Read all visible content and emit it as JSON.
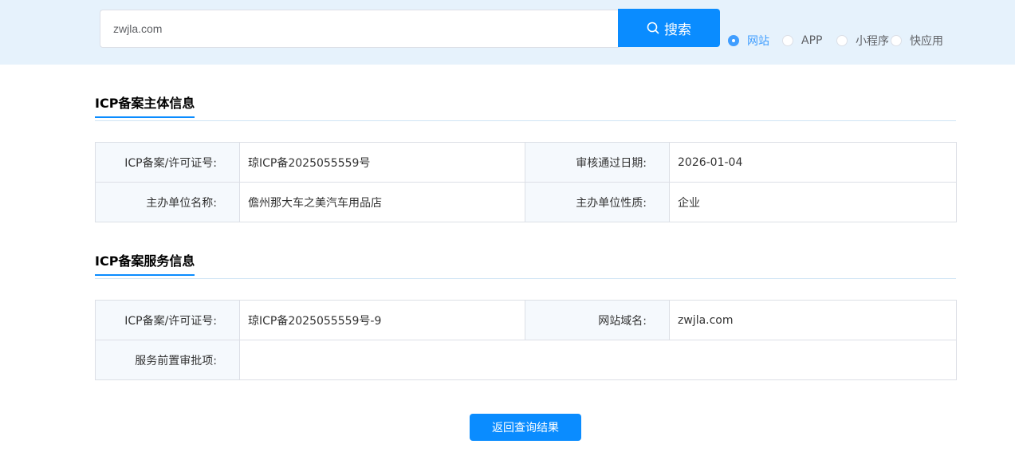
{
  "search": {
    "value": "zwjla.com",
    "button_label": "搜索",
    "types": [
      {
        "label": "网站",
        "checked": true
      },
      {
        "label": "APP",
        "checked": false
      },
      {
        "label": "小程序",
        "checked": false
      },
      {
        "label": "快应用",
        "checked": false
      }
    ]
  },
  "subject": {
    "title": "ICP备案主体信息",
    "license_label": "ICP备案/许可证号:",
    "license_value": "琼ICP备2025055559号",
    "date_label": "审核通过日期:",
    "date_value": "2026-01-04",
    "org_label": "主办单位名称:",
    "org_value": "儋州那大车之美汽车用品店",
    "nature_label": "主办单位性质:",
    "nature_value": "企业"
  },
  "service": {
    "title": "ICP备案服务信息",
    "license_label": "ICP备案/许可证号:",
    "license_value": "琼ICP备2025055559号-9",
    "domain_label": "网站域名:",
    "domain_value": "zwjla.com",
    "approval_label": "服务前置审批项:",
    "approval_value": ""
  },
  "back_button_label": "返回查询结果"
}
